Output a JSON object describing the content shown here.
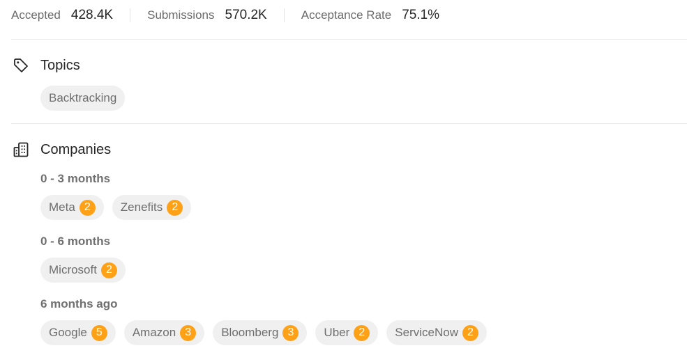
{
  "stats": [
    {
      "label": "Accepted",
      "value": "428.4K"
    },
    {
      "label": "Submissions",
      "value": "570.2K"
    },
    {
      "label": "Acceptance Rate",
      "value": "75.1%"
    }
  ],
  "topics": {
    "title": "Topics",
    "icon": "tag-icon",
    "tags": [
      {
        "label": "Backtracking"
      }
    ]
  },
  "companies": {
    "title": "Companies",
    "icon": "building-icon",
    "badge_color": "#ffa116",
    "groups": [
      {
        "label": "0 - 3 months",
        "tags": [
          {
            "label": "Meta",
            "count": "2"
          },
          {
            "label": "Zenefits",
            "count": "2"
          }
        ]
      },
      {
        "label": "0 - 6 months",
        "tags": [
          {
            "label": "Microsoft",
            "count": "2"
          }
        ]
      },
      {
        "label": "6 months ago",
        "tags": [
          {
            "label": "Google",
            "count": "5"
          },
          {
            "label": "Amazon",
            "count": "3"
          },
          {
            "label": "Bloomberg",
            "count": "3"
          },
          {
            "label": "Uber",
            "count": "2"
          },
          {
            "label": "ServiceNow",
            "count": "2"
          }
        ]
      }
    ]
  }
}
